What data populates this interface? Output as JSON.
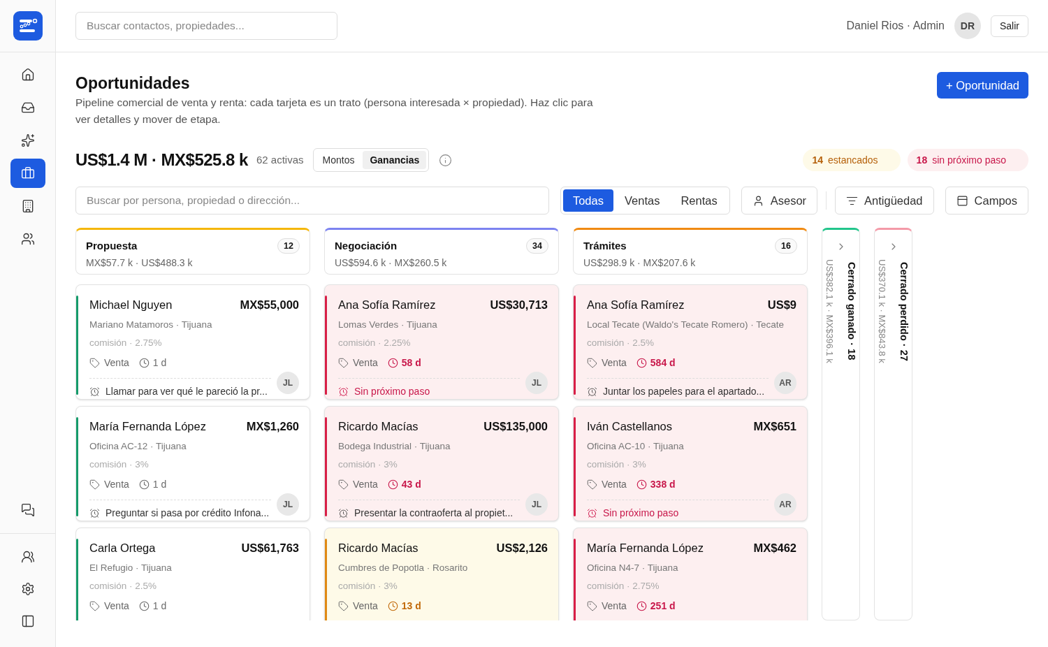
{
  "header": {
    "search_placeholder": "Buscar contactos, propiedades...",
    "user": "Daniel Rios · Admin",
    "avatar": "DR",
    "logout": "Salir"
  },
  "sidebar": {
    "items": [
      {
        "selected": false
      },
      {
        "selected": false
      },
      {
        "selected": false
      },
      {
        "selected": true
      },
      {
        "selected": false
      },
      {
        "selected": false
      }
    ]
  },
  "page": {
    "title": "Oportunidades",
    "description": "Pipeline comercial de venta y renta: cada tarjeta es un trato (persona interesada × propiedad). Haz clic para ver detalles y mover de etapa.",
    "new_button": "+ Oportunidad"
  },
  "summary": {
    "total": "US$1.4 M · MX$525.8 k",
    "active": "62 activas",
    "toggle": [
      {
        "label": "Montos",
        "selected": false
      },
      {
        "label": "Ganancias",
        "selected": true
      }
    ],
    "alerts": [
      {
        "kind": "stale",
        "count": "14",
        "label": "estancados"
      },
      {
        "kind": "missing",
        "count": "18",
        "label": "sin próximo paso"
      }
    ]
  },
  "filters": {
    "search_placeholder": "Buscar por persona, propiedad o dirección...",
    "type_tabs": [
      {
        "label": "Todas",
        "selected": true
      },
      {
        "label": "Ventas",
        "selected": false
      },
      {
        "label": "Rentas",
        "selected": false
      }
    ],
    "buttons": [
      {
        "label": "Asesor"
      },
      {
        "label": "Antigüedad"
      },
      {
        "label": "Campos"
      }
    ]
  },
  "columns": [
    {
      "title": "Propuesta",
      "count": "12",
      "totals": "MX$57.7 k · US$488.3 k",
      "color": "#f5b70a",
      "cards": [
        {
          "name": "Michael Nguyen",
          "amount": "MX$55,000",
          "property": "Mariano Matamoros · Tijuana",
          "commission": "comisión · 2.75%",
          "type": "Venta",
          "age": "1 d",
          "kind": "ok",
          "next_step": {
            "kind": "task",
            "text": "Llamar para ver qué le pareció la pr..."
          },
          "agent": "JL"
        },
        {
          "name": "María Fernanda López",
          "amount": "MX$1,260",
          "property": "Oficina AC-12 · Tijuana",
          "commission": "comisión · 3%",
          "type": "Venta",
          "age": "1 d",
          "kind": "ok",
          "next_step": {
            "kind": "task",
            "text": "Preguntar si pasa por crédito Infona..."
          },
          "agent": "JL"
        },
        {
          "name": "Carla Ortega",
          "amount": "US$61,763",
          "property": "El Refugio · Tijuana",
          "commission": "comisión · 2.5%",
          "type": "Venta",
          "age": "1 d",
          "kind": "ok"
        }
      ]
    },
    {
      "title": "Negociación",
      "count": "34",
      "totals": "US$594.6 k · MX$260.5 k",
      "color": "#7c83f0",
      "cards": [
        {
          "name": "Ana Sofía Ramírez",
          "amount": "US$30,713",
          "property": "Lomas Verdes · Tijuana",
          "commission": "comisión · 2.25%",
          "type": "Venta",
          "age": "58 d",
          "kind": "overdue",
          "next_step": {
            "kind": "missing",
            "text": "Sin próximo paso"
          },
          "agent": "JL"
        },
        {
          "name": "Ricardo Macías",
          "amount": "US$135,000",
          "property": "Bodega Industrial · Tijuana",
          "commission": "comisión · 3%",
          "type": "Venta",
          "age": "43 d",
          "kind": "overdue",
          "next_step": {
            "kind": "task",
            "text": "Presentar la contraoferta al propiet..."
          },
          "agent": "JL"
        },
        {
          "name": "Ricardo Macías",
          "amount": "US$2,126",
          "property": "Cumbres de Popotla · Rosarito",
          "commission": "comisión · 3%",
          "type": "Venta",
          "age": "13 d",
          "kind": "stale"
        }
      ]
    },
    {
      "title": "Trámites",
      "count": "16",
      "totals": "US$298.9 k · MX$207.6 k",
      "color": "#f08a12",
      "cards": [
        {
          "name": "Ana Sofía Ramírez",
          "amount": "US$9",
          "property": "Local Tecate (Waldo's Tecate Romero) · Tecate",
          "commission": "comisión · 2.5%",
          "type": "Venta",
          "age": "584 d",
          "kind": "overdue",
          "next_step": {
            "kind": "task",
            "text": "Juntar los papeles para el apartado..."
          },
          "agent": "AR"
        },
        {
          "name": "Iván Castellanos",
          "amount": "MX$651",
          "property": "Oficina AC-10 · Tijuana",
          "commission": "comisión · 3%",
          "type": "Venta",
          "age": "338 d",
          "kind": "overdue",
          "next_step": {
            "kind": "missing",
            "text": "Sin próximo paso"
          },
          "agent": "AR"
        },
        {
          "name": "María Fernanda López",
          "amount": "MX$462",
          "property": "Oficina N4-7 · Tijuana",
          "commission": "comisión · 2.75%",
          "type": "Venta",
          "age": "251 d",
          "kind": "overdue"
        }
      ]
    }
  ],
  "collapsed_columns": [
    {
      "title": "Cerrado ganado · 18",
      "totals": "US$382.1 k · MX$396.1 k",
      "color": "#22c58b"
    },
    {
      "title": "Cerrado perdido · 27",
      "totals": "US$370.1 k · MX$843.8 k",
      "color": "#f49aa8"
    }
  ]
}
